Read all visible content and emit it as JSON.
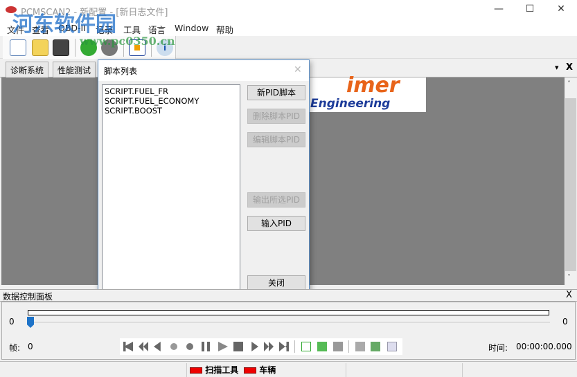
{
  "window": {
    "title": "PCMSCAN2 - 新配置 - [新日志文件]",
    "minimize": "—",
    "maximize": "☐",
    "close": "✕"
  },
  "menu": [
    "文件",
    "查看",
    "OBD-II",
    "记录",
    "工具",
    "语言",
    "Window",
    "帮助"
  ],
  "toolbar": [
    "new-file",
    "open-folder",
    "save",
    "connect",
    "disconnect",
    "fit",
    "info"
  ],
  "tabs": [
    "诊断系统",
    "性能测试"
  ],
  "tabstrip_controls": {
    "dropdown": "▾",
    "close": "X"
  },
  "logo": {
    "brand": "imer",
    "tagline": "Engineering"
  },
  "dialog": {
    "title": "脚本列表",
    "close": "✕",
    "scripts": [
      "SCRIPT.FUEL_FR",
      "SCRIPT.FUEL_ECONOMY",
      "SCRIPT.BOOST"
    ],
    "buttons": {
      "new": "新PID脚本",
      "delete": "删除脚本PID",
      "edit": "编辑脚本PID",
      "export": "输出所选PID",
      "import": "输入PID",
      "close": "关闭"
    }
  },
  "panel": {
    "title": "数据控制面板",
    "close": "X",
    "slider_min": "0",
    "slider_max": "0",
    "slider_value": 0,
    "frame_label": "帧:",
    "frame_value": "0",
    "time_label": "时间:",
    "time_value": "00:00:00.000"
  },
  "status": {
    "scan_tool": "扫描工具",
    "vehicle": "车辆",
    "scan_color": "#e00000",
    "vehicle_color": "#e00000"
  },
  "watermark": {
    "name": "河东软件园",
    "url": "www.pc0350.cn"
  }
}
